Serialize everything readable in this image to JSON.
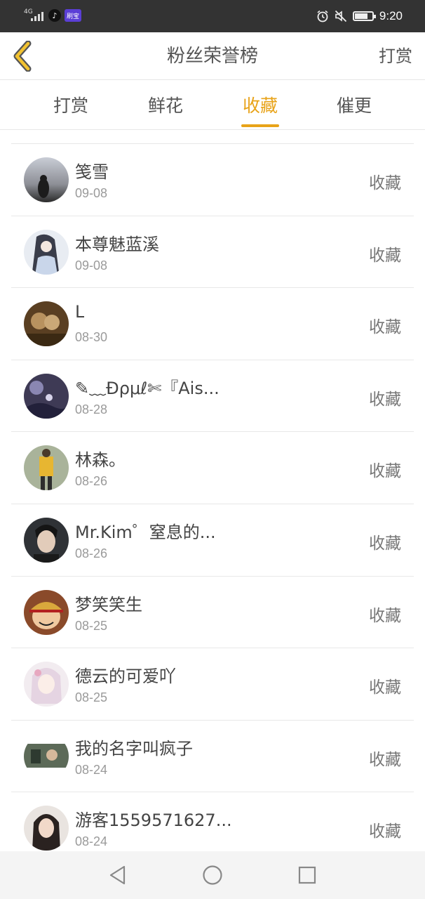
{
  "status_bar": {
    "network": "4G",
    "time": "9:20",
    "badge": "刷宝",
    "icons": [
      "signal-icon",
      "tiktok-icon",
      "alarm-icon",
      "mute-icon",
      "battery-icon"
    ]
  },
  "header": {
    "title": "粉丝荣誉榜",
    "right_action": "打赏",
    "back_icon": "chevron-left-icon"
  },
  "tabs": [
    {
      "label": "打赏",
      "active": false
    },
    {
      "label": "鲜花",
      "active": false
    },
    {
      "label": "收藏",
      "active": true
    },
    {
      "label": "催更",
      "active": false
    }
  ],
  "accent_color": "#e8a319",
  "fans": [
    {
      "name": "笺雪",
      "date": "09-08",
      "action": "收藏"
    },
    {
      "name": "本尊魅蓝溪",
      "date": "09-08",
      "action": "收藏"
    },
    {
      "name": "L",
      "date": "08-30",
      "action": "收藏"
    },
    {
      "name": "✎﹏Ɖρμℓ✄『Ais...",
      "date": "08-28",
      "action": "收藏"
    },
    {
      "name": "林森。",
      "date": "08-26",
      "action": "收藏"
    },
    {
      "name": "Mr.Kim゜窒息的...",
      "date": "08-26",
      "action": "收藏"
    },
    {
      "name": "梦笑笑生",
      "date": "08-25",
      "action": "收藏"
    },
    {
      "name": "德云的可爱吖",
      "date": "08-25",
      "action": "收藏"
    },
    {
      "name": "我的名字叫疯子",
      "date": "08-24",
      "action": "收藏"
    },
    {
      "name": "游客1559571627...",
      "date": "08-24",
      "action": "收藏"
    }
  ],
  "nav_bar": {
    "icons": [
      "back-triangle-icon",
      "home-circle-icon",
      "recents-square-icon"
    ]
  }
}
